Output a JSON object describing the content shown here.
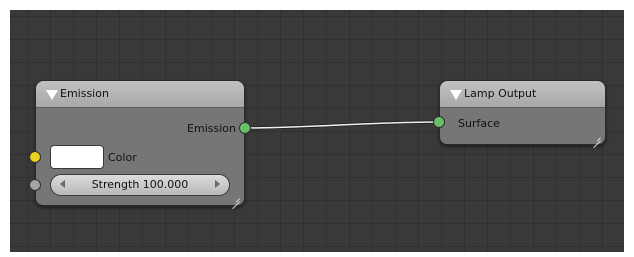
{
  "nodes": {
    "emission": {
      "title": "Emission",
      "output_label": "Emission",
      "color_label": "Color",
      "color_value": "#ffffff",
      "strength_label": "Strength 100.000"
    },
    "lamp_output": {
      "title": "Lamp Output",
      "surface_label": "Surface"
    }
  },
  "colors": {
    "grid_background": "#393939",
    "node_body": "#767676",
    "node_header": "#b4b4b4",
    "shader_socket": "#6bbf64",
    "color_socket": "#e8d21c",
    "value_socket": "#a3a3a3",
    "link": "#f2f2f2"
  }
}
